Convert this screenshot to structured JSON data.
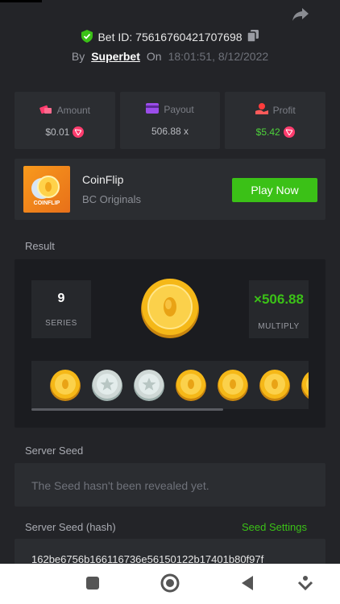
{
  "header": {
    "bet_id_label": "Bet ID: 75616760421707698",
    "by_label": "By",
    "user": "Superbet",
    "on_label": "On",
    "timestamp": "18:01:51, 8/12/2022"
  },
  "stats": {
    "amount": {
      "label": "Amount",
      "value": "$0.01"
    },
    "payout": {
      "label": "Payout",
      "value": "506.88 x"
    },
    "profit": {
      "label": "Profit",
      "value": "$5.42"
    }
  },
  "game": {
    "thumb_text": "COINFLIP",
    "name": "CoinFlip",
    "provider": "BC Originals",
    "play_label": "Play Now"
  },
  "result": {
    "section_label": "Result",
    "series_value": "9",
    "series_label": "SERIES",
    "multiply_value": "×506.88",
    "multiply_label": "MULTIPLY",
    "coins": [
      "gold",
      "silver",
      "silver",
      "gold",
      "gold",
      "gold",
      "gold"
    ]
  },
  "server_seed": {
    "label": "Server Seed",
    "value": "The Seed hasn't been revealed yet."
  },
  "server_seed_hash": {
    "label": "Server Seed (hash)",
    "settings_label": "Seed Settings",
    "value": "162be6756b166116736e56150122b17401b80f97f"
  },
  "colors": {
    "accent_green": "#3bc117",
    "background": "#232428",
    "card": "#2b2d31",
    "gold": "#f5b818",
    "silver": "#cfd8d6"
  },
  "icons": [
    "share-icon",
    "shield-check-icon",
    "copy-icon",
    "amount-icon",
    "payout-icon",
    "profit-icon",
    "trx-icon",
    "nav-square-icon",
    "nav-home-icon",
    "nav-back-icon",
    "nav-down-icon"
  ]
}
